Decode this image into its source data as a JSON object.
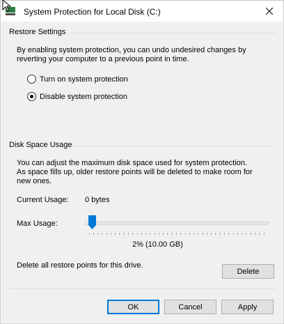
{
  "window": {
    "title": "System Protection for Local Disk (C:)",
    "accent_color": "#0078d7"
  },
  "restore_settings": {
    "title": "Restore Settings",
    "description": "By enabling system protection, you can undo undesired changes by reverting your computer to a previous point in time.",
    "options": [
      {
        "label": "Turn on system protection",
        "selected": false
      },
      {
        "label": "Disable system protection",
        "selected": true
      }
    ]
  },
  "disk_space_usage": {
    "title": "Disk Space Usage",
    "description": "You can adjust the maximum disk space used for system protection. As space fills up, older restore points will be deleted to make room for new ones.",
    "current_usage_label": "Current Usage:",
    "current_usage_value": "0 bytes",
    "max_usage_label": "Max Usage:",
    "max_usage_fraction": 0.02,
    "max_usage_value": "2% (10.00 GB)",
    "delete_text": "Delete all restore points for this drive.",
    "delete_button": "Delete"
  },
  "buttons": {
    "ok": "OK",
    "cancel": "Cancel",
    "apply": "Apply"
  },
  "icons": [
    "window-icon",
    "close-icon",
    "mouse-cursor-icon"
  ]
}
